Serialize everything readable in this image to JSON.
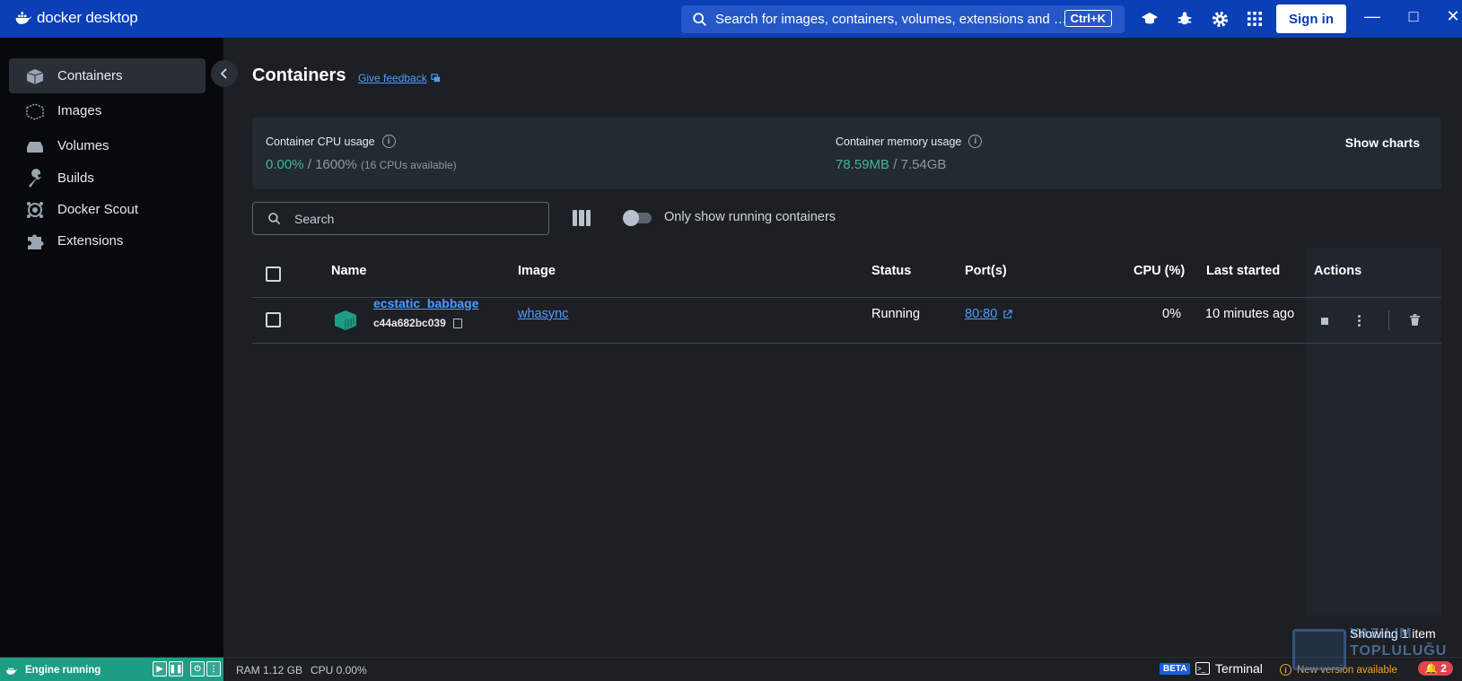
{
  "app": {
    "brand": "docker desktop"
  },
  "topbar": {
    "search_text": "Search for images, containers, volumes, extensions and …",
    "shortcut": "Ctrl+K",
    "signin_label": "Sign in",
    "icons": [
      "learn-icon",
      "bug-icon",
      "settings-icon",
      "grid-icon"
    ]
  },
  "sidebar": {
    "items": [
      {
        "label": "Containers",
        "icon": "containers-icon",
        "active": true
      },
      {
        "label": "Images",
        "icon": "images-icon"
      },
      {
        "label": "Volumes",
        "icon": "volumes-icon"
      },
      {
        "label": "Builds",
        "icon": "wrench-icon"
      },
      {
        "label": "Docker Scout",
        "icon": "scout-icon"
      },
      {
        "label": "Extensions",
        "icon": "puzzle-icon"
      }
    ]
  },
  "main": {
    "title": "Containers",
    "feedback": "Give feedback",
    "usage": {
      "cpu_label": "Container CPU usage",
      "cpu_used": "0.00%",
      "cpu_sep": " / ",
      "cpu_total": "1600%",
      "cpu_note": "(16 CPUs available)",
      "mem_label": "Container memory usage",
      "mem_used": "78.59MB",
      "mem_sep": " / ",
      "mem_total": "7.54GB",
      "show_charts": "Show charts"
    },
    "search_placeholder": "Search",
    "toggle_label": "Only show running containers",
    "table": {
      "headers": {
        "name": "Name",
        "image": "Image",
        "status": "Status",
        "ports": "Port(s)",
        "cpu": "CPU (%)",
        "last_started": "Last started",
        "actions": "Actions"
      },
      "rows": [
        {
          "name": "ecstatic_babbage",
          "id": "c44a682bc039",
          "image": "whasync",
          "status": "Running",
          "ports": "80:80",
          "cpu": "0%",
          "last_started": "10 minutes ago"
        }
      ]
    },
    "showing": "Showing 1 item"
  },
  "footer": {
    "engine_status": "Engine running",
    "ram": "RAM 1.12 GB",
    "cpu": "CPU 0.00%",
    "beta": "BETA",
    "terminal": "Terminal",
    "update": "New version available",
    "notifications": "2"
  },
  "watermark": {
    "line1": "YAZILIM",
    "line2": "TOPLULUĞU"
  },
  "colors": {
    "topbar": "#0a3fb6",
    "accent_green": "#3cb89b",
    "link": "#4e9bff",
    "engine": "#1d9e84"
  }
}
